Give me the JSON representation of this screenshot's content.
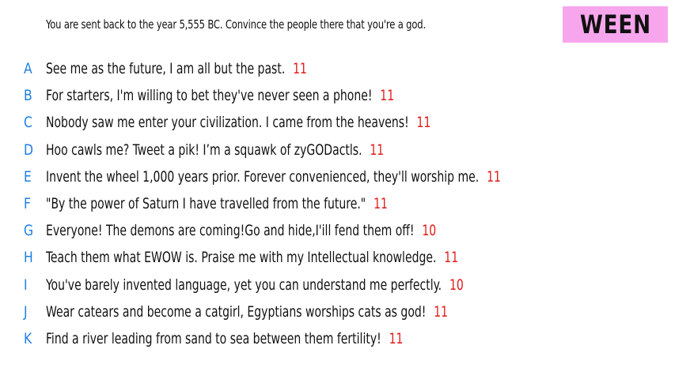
{
  "header": {
    "prompt": "You are sent back to the year 5,555 BC. Convince the people there that you're a god.",
    "badge_label": "WEEN"
  },
  "colors": {
    "badge_background": "#f7a6ee",
    "letter": "#1e7fe6",
    "score": "#e31b1b",
    "text": "#111111"
  },
  "responses": [
    {
      "letter": "A",
      "text": "See me as the future, I am all but the past.",
      "score": "11"
    },
    {
      "letter": "B",
      "text": "For starters, I'm willing to bet they've never seen a phone!",
      "score": "11"
    },
    {
      "letter": "C",
      "text": "Nobody saw me enter your civilization. I came from the heavens!",
      "score": "11"
    },
    {
      "letter": "D",
      "text": "Hoo cawls me? Tweet a pik! I’m a squawk of zyGODactls.",
      "score": "11"
    },
    {
      "letter": "E",
      "text": "Invent the wheel 1,000 years prior. Forever convenienced, they'll worship me.",
      "score": "11"
    },
    {
      "letter": "F",
      "text": "\"By the power of Saturn I have travelled from the future.\"",
      "score": "11"
    },
    {
      "letter": "G",
      "text": "Everyone! The demons are coming!Go and hide,I'ill fend them off!",
      "score": "10"
    },
    {
      "letter": "H",
      "text": "Teach them what EWOW is. Praise me with my Intellectual knowledge.",
      "score": "11"
    },
    {
      "letter": "I",
      "text": "You've barely invented language, yet you can understand me perfectly.",
      "score": "10"
    },
    {
      "letter": "J",
      "text": "Wear catears and become a catgirl, Egyptians worships cats as god!",
      "score": "11"
    },
    {
      "letter": "K",
      "text": "Find a river leading from sand to sea between them fertility!",
      "score": "11"
    }
  ]
}
